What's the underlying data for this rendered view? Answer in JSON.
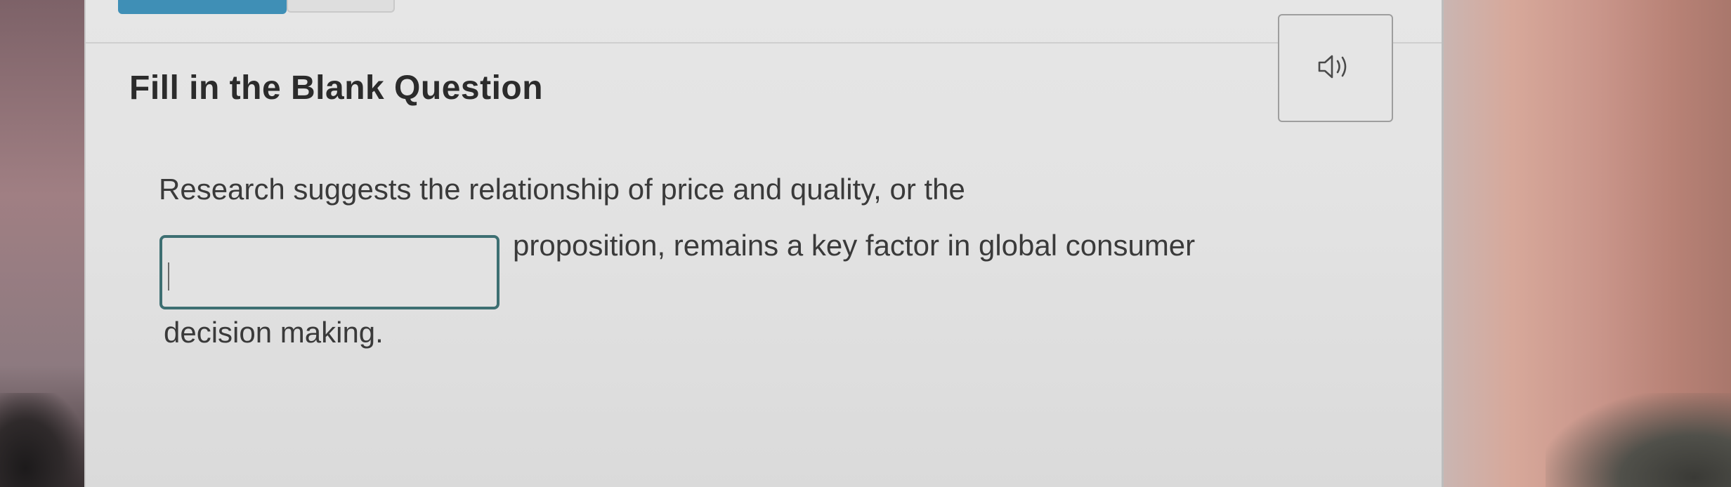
{
  "question": {
    "title": "Fill in the Blank Question",
    "text_before_blank": "Research suggests the relationship of price and quality, or the",
    "text_after_blank": "proposition, remains a key factor in global consumer",
    "text_end": "decision making.",
    "blank_value": ""
  },
  "audio_button": {
    "icon": "speaker-icon"
  },
  "colors": {
    "tab_accent": "#3f8fb6",
    "blank_border": "#3d6f72",
    "title_text": "#2b2b2b",
    "body_text": "#3a3a3a"
  }
}
